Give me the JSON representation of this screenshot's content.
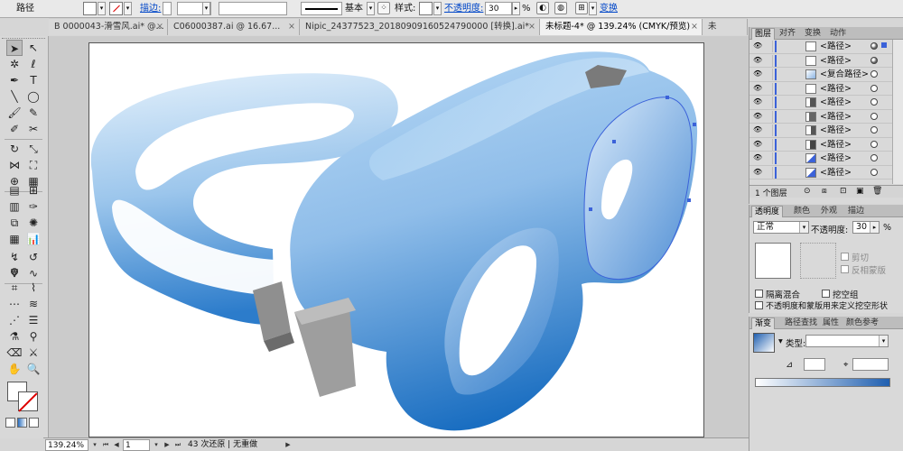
{
  "control_bar": {
    "object_type": "路径",
    "stroke_label": "描边:",
    "stroke_width_value": "",
    "line_style_label": "基本",
    "style_label": "样式:",
    "opacity_label": "不透明度:",
    "opacity_value": "30",
    "percent": "%",
    "transform_label": "变换"
  },
  "tabs": [
    {
      "label": "B 0000043-滑雪风.ai* @..."
    },
    {
      "label": "C06000387.ai @ 16.67..."
    },
    {
      "label": "Nipic_24377523_20180909160524790000  [转换].ai*"
    },
    {
      "label": "未标题-4* @ 139.24% (CMYK/预览)"
    },
    {
      "label": "未"
    }
  ],
  "tab_close": "×",
  "status_bar": {
    "zoom": "139.24%",
    "page": "1",
    "history": "43 次还原 | 无重做"
  },
  "layers_panel": {
    "tabs": [
      "图层",
      "对齐",
      "变换",
      "动作"
    ],
    "rows": [
      {
        "name": "<路径>"
      },
      {
        "name": "<路径>"
      },
      {
        "name": "<复合路径>"
      },
      {
        "name": "<路径>"
      },
      {
        "name": "<路径>"
      },
      {
        "name": "<路径>"
      },
      {
        "name": "<路径>"
      },
      {
        "name": "<路径>"
      },
      {
        "name": "<路径>"
      },
      {
        "name": "<路径>"
      }
    ],
    "footer_count": "1 个图层"
  },
  "transparency_panel": {
    "tabs": [
      "透明度",
      "颜色",
      "外观",
      "描边"
    ],
    "blend_mode": "正常",
    "opacity_label": "不透明度:",
    "opacity_value": "30",
    "percent": "%",
    "clip_label": "剪切",
    "invert_label": "反相蒙版",
    "isolate_label": "隔离混合",
    "knockout_label": "挖空组",
    "opacity_mask_label": "不透明度和蒙版用来定义挖空形状"
  },
  "gradient_panel": {
    "tabs": [
      "渐变",
      "路径查找",
      "属性",
      "颜色参考"
    ],
    "type_label": "类型:",
    "type_value": ""
  },
  "colors": {
    "artboard": "#ffffff",
    "pasteboard": "#cbcbcb",
    "accent": "#0046c8",
    "selection": "#3b62d9",
    "gradient_light": "#d6ebfb",
    "gradient_dark": "#1f72c4"
  }
}
